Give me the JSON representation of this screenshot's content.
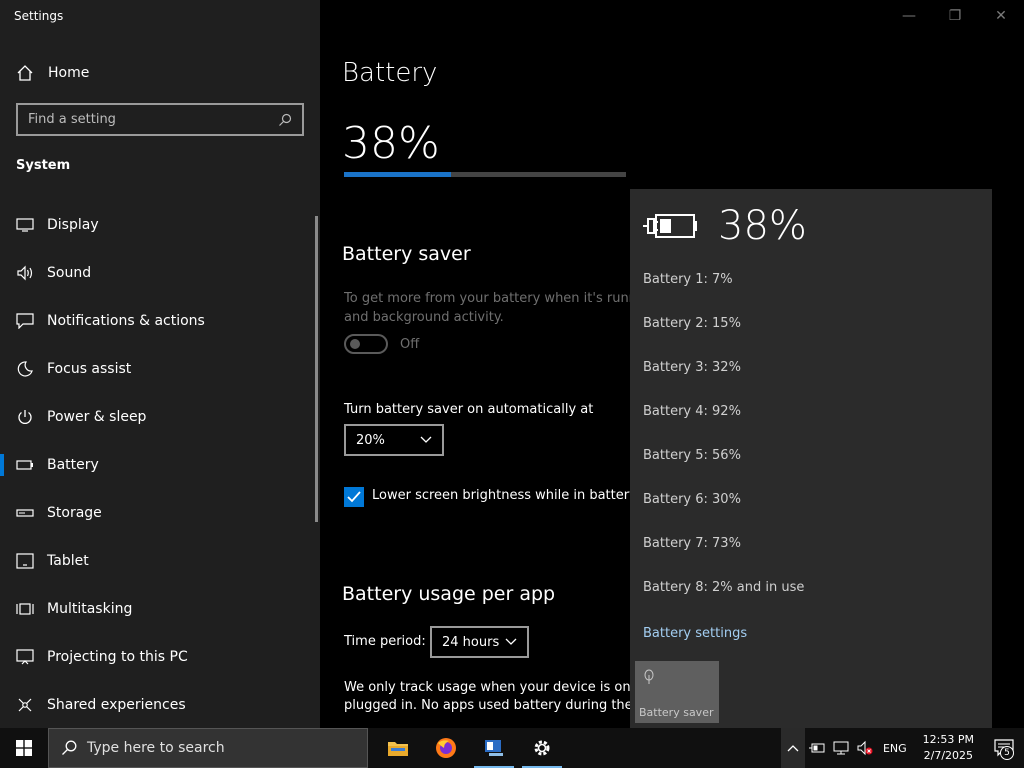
{
  "window": {
    "title": "Settings"
  },
  "sidebar": {
    "home_label": "Home",
    "search_placeholder": "Find a setting",
    "section": "System",
    "items": [
      {
        "label": "Display",
        "icon": "display-icon"
      },
      {
        "label": "Sound",
        "icon": "sound-icon"
      },
      {
        "label": "Notifications & actions",
        "icon": "notifications-icon"
      },
      {
        "label": "Focus assist",
        "icon": "moon-icon"
      },
      {
        "label": "Power & sleep",
        "icon": "power-icon"
      },
      {
        "label": "Battery",
        "icon": "battery-icon",
        "active": true
      },
      {
        "label": "Storage",
        "icon": "storage-icon"
      },
      {
        "label": "Tablet",
        "icon": "tablet-icon"
      },
      {
        "label": "Multitasking",
        "icon": "multitasking-icon"
      },
      {
        "label": "Projecting to this PC",
        "icon": "projecting-icon"
      },
      {
        "label": "Shared experiences",
        "icon": "shared-icon"
      }
    ]
  },
  "main": {
    "title": "Battery",
    "percent": "38%",
    "percent_value": 38,
    "saver": {
      "title": "Battery saver",
      "description_line1": "To get more from your battery when it's runnin",
      "description_line2": "and background activity.",
      "toggle_state": "Off",
      "auto_label": "Turn battery saver on automatically at",
      "auto_value": "20%",
      "brightness_label": "Lower screen brightness while in battery s"
    },
    "usage": {
      "title": "Battery usage per app",
      "time_period_label": "Time period:",
      "time_period_value": "24 hours",
      "note_line1": "We only track usage when your device is on ba",
      "note_line2": "plugged in. No apps used battery during the s"
    }
  },
  "flyout": {
    "percent": "38%",
    "batteries": [
      "Battery 1: 7%",
      "Battery 2: 15%",
      "Battery 3: 32%",
      "Battery 4: 92%",
      "Battery 5: 56%",
      "Battery 6: 30%",
      "Battery 7: 73%",
      "Battery 8: 2% and in use"
    ],
    "settings_link": "Battery settings",
    "saver_tile": "Battery saver"
  },
  "taskbar": {
    "search_placeholder": "Type here to search",
    "language": "ENG",
    "time": "12:53 PM",
    "date": "2/7/2025",
    "notification_count": "5"
  },
  "colors": {
    "accent": "#0078d7",
    "link": "#a3cef2"
  }
}
